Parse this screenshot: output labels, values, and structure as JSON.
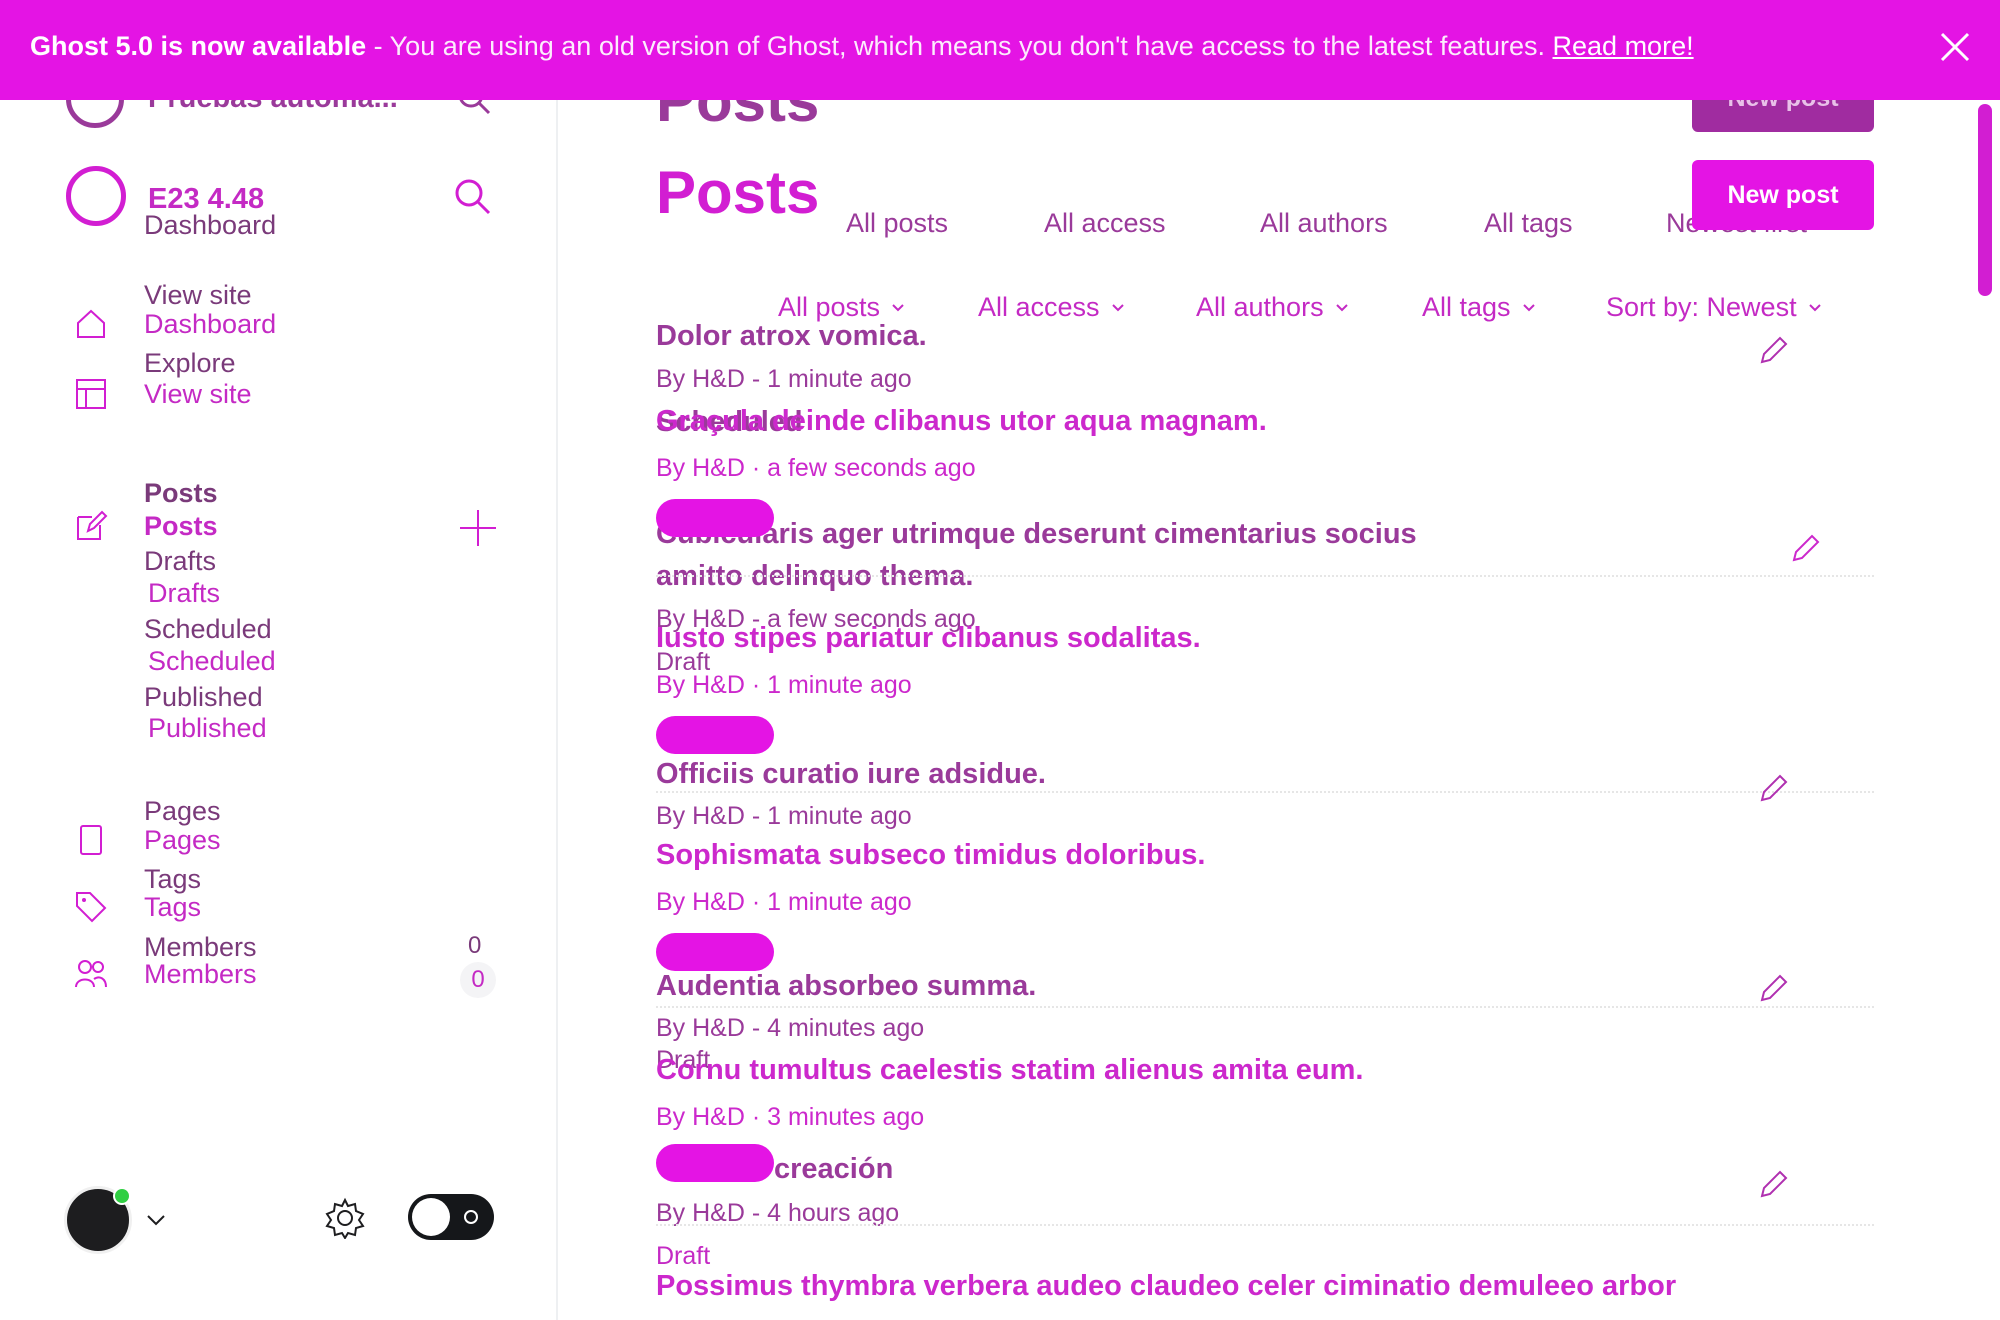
{
  "banner": {
    "title": "Ghost 5.0 is now available",
    "message": "- You are using an old version of Ghost, which means you don't have access to the latest features.",
    "link": "Read more!",
    "close_icon": "close-icon"
  },
  "ghost_layer": {
    "workspace": "Pruebas automa...",
    "title": "Posts",
    "new_post": "New post",
    "sub_dashboard": "Dashboard",
    "view_site": "View site",
    "explore": "Explore",
    "posts": "Posts",
    "drafts": "Drafts",
    "scheduled": "Scheduled",
    "published": "Published",
    "pages": "Pages",
    "tags": "Tags",
    "members": "Members",
    "members_count": "0",
    "filters": [
      "All posts",
      "All access",
      "All authors",
      "All tags",
      "Newest first"
    ],
    "posts_list": [
      {
        "title": "Dolor atrox vomica.",
        "meta": "By H&D - 1 minute ago"
      },
      {
        "title": "Cubicularis ager utrimque deserunt cimentarius socius",
        "title2": "amitto delinquo thema.",
        "meta": "By H&D - a few seconds ago",
        "status": "Draft"
      },
      {
        "title": "Officiis curatio iure adsidue.",
        "meta": "By H&D - 1 minute ago"
      },
      {
        "title": "Audentia absorbeo summa.",
        "meta": "By H&D - 4 minutes ago",
        "status": "Draft"
      },
      {
        "title": "creación",
        "meta": "By H&D - 4 hours ago",
        "status": "Draft"
      }
    ],
    "scheduled_label": "Scheduled"
  },
  "sidebar": {
    "workspace": "E23 4.48",
    "items": [
      {
        "label": "Dashboard",
        "icon": "home-icon"
      },
      {
        "label": "View site",
        "icon": "layout-icon"
      },
      {
        "label": "Posts",
        "icon": "edit-icon"
      },
      {
        "label": "Pages",
        "icon": "page-icon"
      },
      {
        "label": "Tags",
        "icon": "tag-icon"
      },
      {
        "label": "Members",
        "icon": "members-icon"
      }
    ],
    "sub_items": [
      "Drafts",
      "Scheduled",
      "Published"
    ],
    "members_count": "0"
  },
  "main": {
    "title": "Posts",
    "new_post": "New post",
    "filters": [
      "All posts",
      "All access",
      "All authors",
      "All tags",
      "Sort by: Newest"
    ],
    "posts": [
      {
        "title": "Graçula deinde clibanus utor aqua magnam.",
        "meta": "By H&D · a few seconds ago"
      },
      {
        "title": "Iusto stipes pariatur clibanus sodalitas.",
        "meta": "By H&D · 1 minute ago"
      },
      {
        "title": "Sophismata subseco timidus doloribus.",
        "meta": "By H&D · 1 minute ago"
      },
      {
        "title": "Cornu tumultus caelestis statim alienus amita eum.",
        "meta": "By H&D · 3 minutes ago"
      },
      {
        "title": "Possimus thymbra verbera audeo claudeo celer ciminatio demuleeo arbor",
        "meta": ""
      }
    ]
  },
  "colors": {
    "accent": "#e414e4",
    "text": "#cc28cc",
    "ghost_text": "#7a3a7a"
  }
}
